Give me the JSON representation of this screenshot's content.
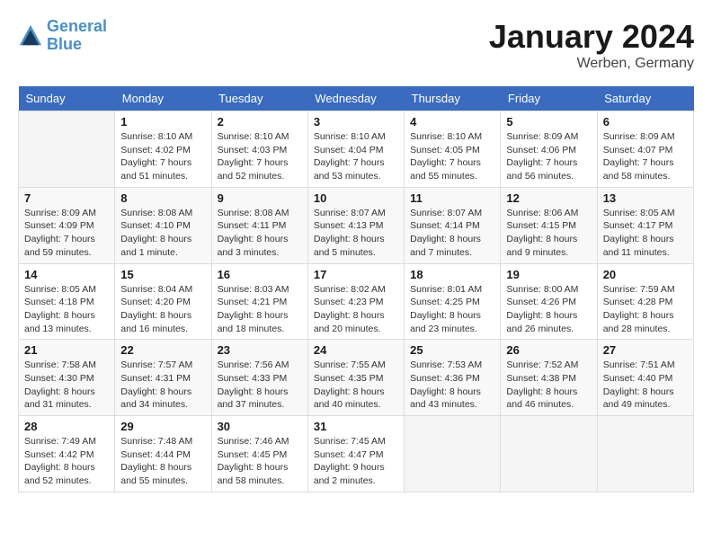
{
  "header": {
    "logo_line1": "General",
    "logo_line2": "Blue",
    "title": "January 2024",
    "subtitle": "Werben, Germany"
  },
  "days_of_week": [
    "Sunday",
    "Monday",
    "Tuesday",
    "Wednesday",
    "Thursday",
    "Friday",
    "Saturday"
  ],
  "weeks": [
    [
      {
        "day": "",
        "sunrise": "",
        "sunset": "",
        "daylight": ""
      },
      {
        "day": "1",
        "sunrise": "Sunrise: 8:10 AM",
        "sunset": "Sunset: 4:02 PM",
        "daylight": "Daylight: 7 hours and 51 minutes."
      },
      {
        "day": "2",
        "sunrise": "Sunrise: 8:10 AM",
        "sunset": "Sunset: 4:03 PM",
        "daylight": "Daylight: 7 hours and 52 minutes."
      },
      {
        "day": "3",
        "sunrise": "Sunrise: 8:10 AM",
        "sunset": "Sunset: 4:04 PM",
        "daylight": "Daylight: 7 hours and 53 minutes."
      },
      {
        "day": "4",
        "sunrise": "Sunrise: 8:10 AM",
        "sunset": "Sunset: 4:05 PM",
        "daylight": "Daylight: 7 hours and 55 minutes."
      },
      {
        "day": "5",
        "sunrise": "Sunrise: 8:09 AM",
        "sunset": "Sunset: 4:06 PM",
        "daylight": "Daylight: 7 hours and 56 minutes."
      },
      {
        "day": "6",
        "sunrise": "Sunrise: 8:09 AM",
        "sunset": "Sunset: 4:07 PM",
        "daylight": "Daylight: 7 hours and 58 minutes."
      }
    ],
    [
      {
        "day": "7",
        "sunrise": "Sunrise: 8:09 AM",
        "sunset": "Sunset: 4:09 PM",
        "daylight": "Daylight: 7 hours and 59 minutes."
      },
      {
        "day": "8",
        "sunrise": "Sunrise: 8:08 AM",
        "sunset": "Sunset: 4:10 PM",
        "daylight": "Daylight: 8 hours and 1 minute."
      },
      {
        "day": "9",
        "sunrise": "Sunrise: 8:08 AM",
        "sunset": "Sunset: 4:11 PM",
        "daylight": "Daylight: 8 hours and 3 minutes."
      },
      {
        "day": "10",
        "sunrise": "Sunrise: 8:07 AM",
        "sunset": "Sunset: 4:13 PM",
        "daylight": "Daylight: 8 hours and 5 minutes."
      },
      {
        "day": "11",
        "sunrise": "Sunrise: 8:07 AM",
        "sunset": "Sunset: 4:14 PM",
        "daylight": "Daylight: 8 hours and 7 minutes."
      },
      {
        "day": "12",
        "sunrise": "Sunrise: 8:06 AM",
        "sunset": "Sunset: 4:15 PM",
        "daylight": "Daylight: 8 hours and 9 minutes."
      },
      {
        "day": "13",
        "sunrise": "Sunrise: 8:05 AM",
        "sunset": "Sunset: 4:17 PM",
        "daylight": "Daylight: 8 hours and 11 minutes."
      }
    ],
    [
      {
        "day": "14",
        "sunrise": "Sunrise: 8:05 AM",
        "sunset": "Sunset: 4:18 PM",
        "daylight": "Daylight: 8 hours and 13 minutes."
      },
      {
        "day": "15",
        "sunrise": "Sunrise: 8:04 AM",
        "sunset": "Sunset: 4:20 PM",
        "daylight": "Daylight: 8 hours and 16 minutes."
      },
      {
        "day": "16",
        "sunrise": "Sunrise: 8:03 AM",
        "sunset": "Sunset: 4:21 PM",
        "daylight": "Daylight: 8 hours and 18 minutes."
      },
      {
        "day": "17",
        "sunrise": "Sunrise: 8:02 AM",
        "sunset": "Sunset: 4:23 PM",
        "daylight": "Daylight: 8 hours and 20 minutes."
      },
      {
        "day": "18",
        "sunrise": "Sunrise: 8:01 AM",
        "sunset": "Sunset: 4:25 PM",
        "daylight": "Daylight: 8 hours and 23 minutes."
      },
      {
        "day": "19",
        "sunrise": "Sunrise: 8:00 AM",
        "sunset": "Sunset: 4:26 PM",
        "daylight": "Daylight: 8 hours and 26 minutes."
      },
      {
        "day": "20",
        "sunrise": "Sunrise: 7:59 AM",
        "sunset": "Sunset: 4:28 PM",
        "daylight": "Daylight: 8 hours and 28 minutes."
      }
    ],
    [
      {
        "day": "21",
        "sunrise": "Sunrise: 7:58 AM",
        "sunset": "Sunset: 4:30 PM",
        "daylight": "Daylight: 8 hours and 31 minutes."
      },
      {
        "day": "22",
        "sunrise": "Sunrise: 7:57 AM",
        "sunset": "Sunset: 4:31 PM",
        "daylight": "Daylight: 8 hours and 34 minutes."
      },
      {
        "day": "23",
        "sunrise": "Sunrise: 7:56 AM",
        "sunset": "Sunset: 4:33 PM",
        "daylight": "Daylight: 8 hours and 37 minutes."
      },
      {
        "day": "24",
        "sunrise": "Sunrise: 7:55 AM",
        "sunset": "Sunset: 4:35 PM",
        "daylight": "Daylight: 8 hours and 40 minutes."
      },
      {
        "day": "25",
        "sunrise": "Sunrise: 7:53 AM",
        "sunset": "Sunset: 4:36 PM",
        "daylight": "Daylight: 8 hours and 43 minutes."
      },
      {
        "day": "26",
        "sunrise": "Sunrise: 7:52 AM",
        "sunset": "Sunset: 4:38 PM",
        "daylight": "Daylight: 8 hours and 46 minutes."
      },
      {
        "day": "27",
        "sunrise": "Sunrise: 7:51 AM",
        "sunset": "Sunset: 4:40 PM",
        "daylight": "Daylight: 8 hours and 49 minutes."
      }
    ],
    [
      {
        "day": "28",
        "sunrise": "Sunrise: 7:49 AM",
        "sunset": "Sunset: 4:42 PM",
        "daylight": "Daylight: 8 hours and 52 minutes."
      },
      {
        "day": "29",
        "sunrise": "Sunrise: 7:48 AM",
        "sunset": "Sunset: 4:44 PM",
        "daylight": "Daylight: 8 hours and 55 minutes."
      },
      {
        "day": "30",
        "sunrise": "Sunrise: 7:46 AM",
        "sunset": "Sunset: 4:45 PM",
        "daylight": "Daylight: 8 hours and 58 minutes."
      },
      {
        "day": "31",
        "sunrise": "Sunrise: 7:45 AM",
        "sunset": "Sunset: 4:47 PM",
        "daylight": "Daylight: 9 hours and 2 minutes."
      },
      {
        "day": "",
        "sunrise": "",
        "sunset": "",
        "daylight": ""
      },
      {
        "day": "",
        "sunrise": "",
        "sunset": "",
        "daylight": ""
      },
      {
        "day": "",
        "sunrise": "",
        "sunset": "",
        "daylight": ""
      }
    ]
  ]
}
